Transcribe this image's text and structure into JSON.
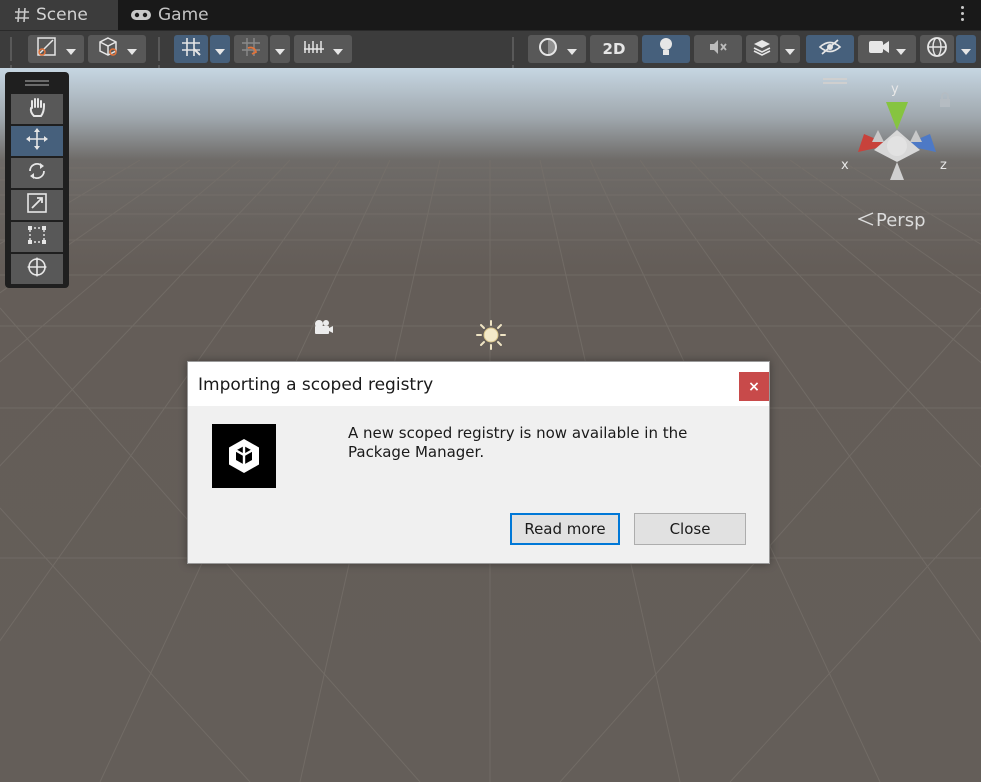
{
  "tabs": [
    {
      "label": "Scene",
      "icon": "hash-icon",
      "active": true
    },
    {
      "label": "Game",
      "icon": "gamepad-icon",
      "active": false
    }
  ],
  "toolbar": {
    "mode_2d_label": "2D"
  },
  "scene": {
    "view_label": "Persp",
    "axes": {
      "x": "x",
      "y": "y",
      "z": "z"
    }
  },
  "dialog": {
    "title": "Importing a scoped registry",
    "close_glyph": "×",
    "message": "A new scoped registry is now available in the Package Manager.",
    "buttons": {
      "read_more": "Read more",
      "close": "Close"
    }
  },
  "colors": {
    "accent_blue": "#46607c",
    "dialog_primary_border": "#0078d7",
    "close_red": "#c84a4a"
  }
}
